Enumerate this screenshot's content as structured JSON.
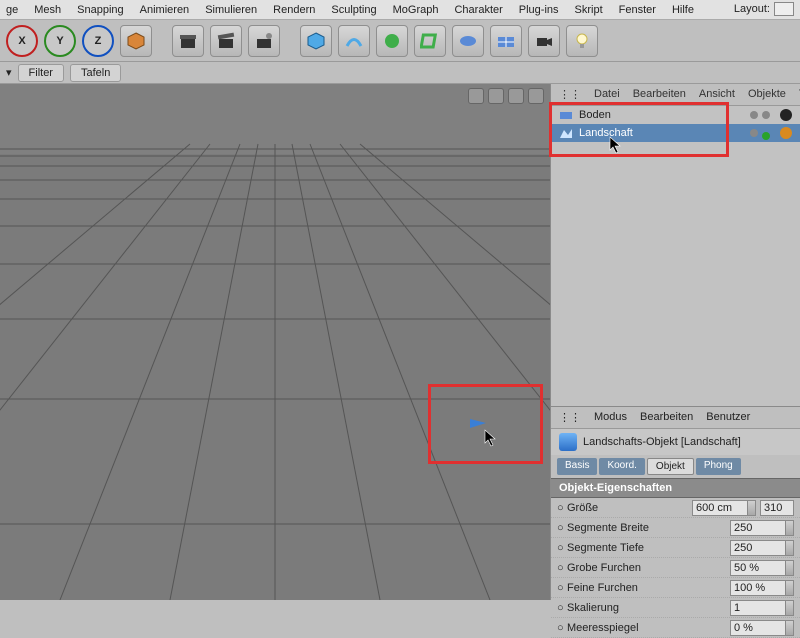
{
  "menubar": {
    "items": [
      "ge",
      "Mesh",
      "Snapping",
      "Animieren",
      "Simulieren",
      "Rendern",
      "Sculpting",
      "MoGraph",
      "Charakter",
      "Plug-ins",
      "Skript",
      "Fenster",
      "Hilfe"
    ],
    "layout_label": "Layout:"
  },
  "subbar": {
    "filter": "Filter",
    "tafeln": "Tafeln"
  },
  "axis": {
    "x": "X",
    "y": "Y",
    "z": "Z"
  },
  "object_manager": {
    "menu": [
      "Datei",
      "Bearbeiten",
      "Ansicht",
      "Objekte",
      "T"
    ],
    "items": [
      {
        "label": "Boden",
        "selected": false
      },
      {
        "label": "Landschaft",
        "selected": true
      }
    ]
  },
  "attribute_manager": {
    "menu": [
      "Modus",
      "Bearbeiten",
      "Benutzer"
    ],
    "title": "Landschafts-Objekt [Landschaft]",
    "tabs": [
      "Basis",
      "Koord.",
      "Objekt",
      "Phong"
    ],
    "tab_active": 2,
    "section_header": "Objekt-Eigenschaften",
    "props": [
      {
        "label": "Größe",
        "value": "600 cm",
        "extra": "310"
      },
      {
        "label": "Segmente Breite",
        "value": "250"
      },
      {
        "label": "Segmente Tiefe",
        "value": "250"
      },
      {
        "label": "Grobe Furchen",
        "value": "50 %"
      },
      {
        "label": "Feine Furchen",
        "value": "100 %"
      },
      {
        "label": "Skalierung",
        "value": "1"
      },
      {
        "label": "Meeresspiegel",
        "value": "0 %"
      }
    ]
  }
}
